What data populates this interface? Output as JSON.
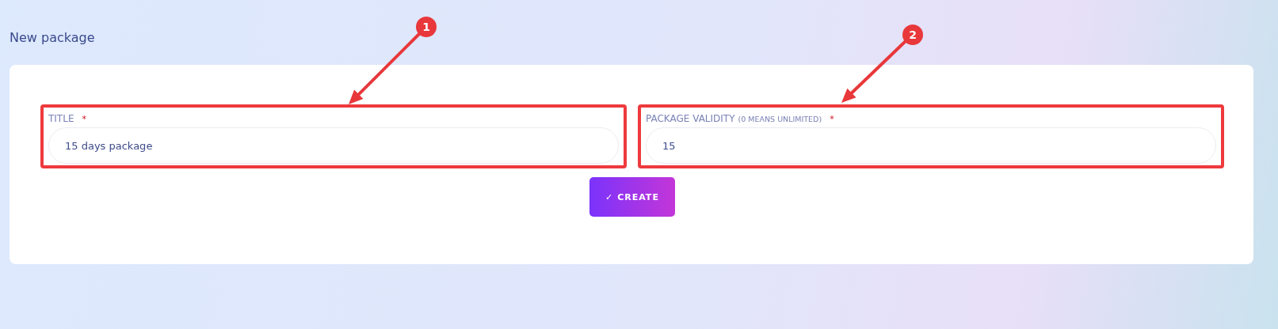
{
  "heading": "New package",
  "fields": [
    {
      "label": "TITLE",
      "required": true,
      "highlighted": true,
      "value": "15 days package"
    },
    {
      "label": "PACKAGE VALIDITY",
      "note": "(0 MEANS UNLIMITED)",
      "required": true,
      "highlighted": true,
      "value": "15"
    }
  ],
  "required_mark": "*",
  "submit_button": {
    "icon": "✓",
    "label": "CREATE"
  },
  "annotations": [
    {
      "number": "1"
    },
    {
      "number": "2"
    }
  ]
}
